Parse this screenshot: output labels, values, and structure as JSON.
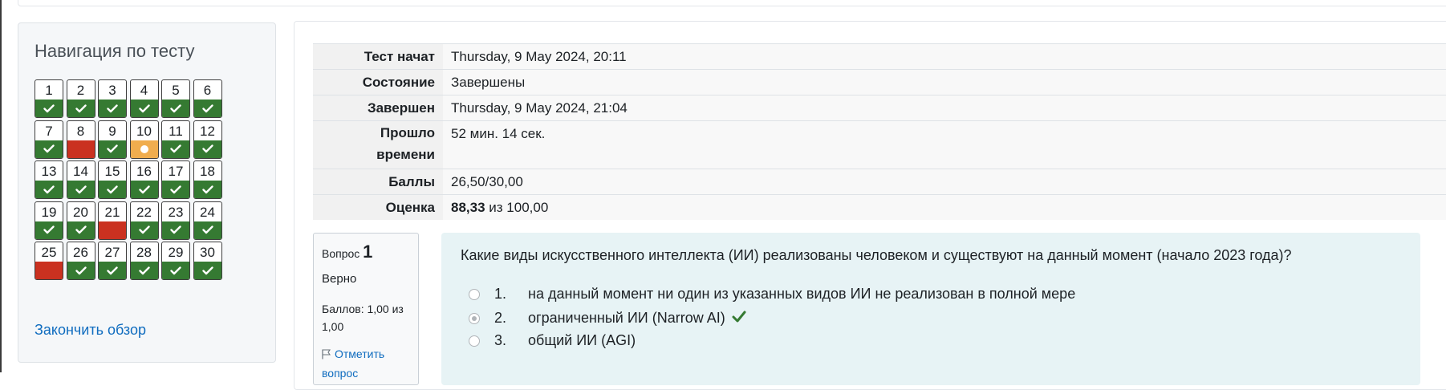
{
  "navigation": {
    "title": "Навигация по тесту",
    "finish_link": "Закончить обзор",
    "questions": [
      {
        "num": "1",
        "state": "correct"
      },
      {
        "num": "2",
        "state": "correct"
      },
      {
        "num": "3",
        "state": "correct"
      },
      {
        "num": "4",
        "state": "correct"
      },
      {
        "num": "5",
        "state": "correct"
      },
      {
        "num": "6",
        "state": "correct"
      },
      {
        "num": "7",
        "state": "correct"
      },
      {
        "num": "8",
        "state": "incorrect"
      },
      {
        "num": "9",
        "state": "correct"
      },
      {
        "num": "10",
        "state": "partial"
      },
      {
        "num": "11",
        "state": "correct"
      },
      {
        "num": "12",
        "state": "correct"
      },
      {
        "num": "13",
        "state": "correct"
      },
      {
        "num": "14",
        "state": "correct"
      },
      {
        "num": "15",
        "state": "correct"
      },
      {
        "num": "16",
        "state": "correct"
      },
      {
        "num": "17",
        "state": "correct"
      },
      {
        "num": "18",
        "state": "correct"
      },
      {
        "num": "19",
        "state": "correct"
      },
      {
        "num": "20",
        "state": "correct"
      },
      {
        "num": "21",
        "state": "incorrect"
      },
      {
        "num": "22",
        "state": "correct"
      },
      {
        "num": "23",
        "state": "correct"
      },
      {
        "num": "24",
        "state": "correct"
      },
      {
        "num": "25",
        "state": "incorrect"
      },
      {
        "num": "26",
        "state": "correct"
      },
      {
        "num": "27",
        "state": "correct"
      },
      {
        "num": "28",
        "state": "correct"
      },
      {
        "num": "29",
        "state": "correct"
      },
      {
        "num": "30",
        "state": "correct"
      }
    ]
  },
  "summary": {
    "started_label": "Тест начат",
    "started_value": "Thursday, 9 May 2024, 20:11",
    "state_label": "Состояние",
    "state_value": "Завершены",
    "completed_label": "Завершен",
    "completed_value": "Thursday, 9 May 2024, 21:04",
    "time_label_1": "Прошло",
    "time_label_2": "времени",
    "time_value": "52 мин. 14 сек.",
    "marks_label": "Баллы",
    "marks_value": "26,50/30,00",
    "grade_label": "Оценка",
    "grade_value": "88,33",
    "grade_out_of": "из 100,00"
  },
  "question": {
    "label": "Вопрос",
    "number": "1",
    "state": "Верно",
    "grade": "Баллов: 1,00 из 1,00",
    "flag": "Отметить вопрос",
    "text": "Какие виды искусственного интеллекта (ИИ) реализованы человеком и существуют на данный момент (начало 2023 года)?",
    "answers": [
      {
        "num": "1.",
        "text": "на данный момент ни один из указанных видов ИИ не реализован в полной мере",
        "checked": false,
        "correct_mark": false
      },
      {
        "num": "2.",
        "text": "ограниченный ИИ (Narrow AI)",
        "checked": true,
        "correct_mark": true
      },
      {
        "num": "3.",
        "text": "общий ИИ (AGI)",
        "checked": false,
        "correct_mark": false
      }
    ]
  },
  "colors": {
    "correct": "#357a32",
    "incorrect": "#ca3120",
    "partial": "#f0ad4e",
    "link": "#0f6cbf",
    "question_bg": "#e7f3f5"
  }
}
